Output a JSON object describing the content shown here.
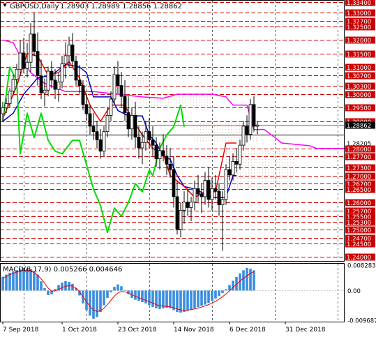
{
  "chart_data": {
    "type": "candlestick",
    "symbol_label": "GBPUSD,Daily",
    "ohlc_label": "1.28903 1.28989 1.28856 1.28862",
    "price_axis": {
      "ylim": [
        1.2385,
        1.3345
      ],
      "levels": [
        {
          "value": 1.334,
          "label": "1.33400",
          "style": "red"
        },
        {
          "value": 1.33,
          "label": "1.33000",
          "style": "red"
        },
        {
          "value": 1.327,
          "label": "1.32700",
          "style": "red"
        },
        {
          "value": 1.325,
          "label": "1.32500",
          "style": "red"
        },
        {
          "value": 1.32,
          "label": "1.32000",
          "style": "red"
        },
        {
          "value": 1.315,
          "label": "1.31500",
          "style": "red"
        },
        {
          "value": 1.31,
          "label": "1.31000",
          "style": "red"
        },
        {
          "value": 1.307,
          "label": "1.30700",
          "style": "red"
        },
        {
          "value": 1.303,
          "label": "1.30300",
          "style": "red"
        },
        {
          "value": 1.3,
          "label": "1.30000",
          "style": "red"
        },
        {
          "value": 1.295,
          "label": "1.29500",
          "style": "red"
        },
        {
          "value": 1.29,
          "label": "1.29000",
          "style": "red"
        },
        {
          "value": 1.28862,
          "label": "1.28862",
          "style": "current"
        },
        {
          "value": 1.285,
          "label": "",
          "style": "black"
        },
        {
          "value": 1.282,
          "label": "1.28205",
          "style": "plain"
        },
        {
          "value": 1.28,
          "label": "1.28000",
          "style": "red"
        },
        {
          "value": 1.277,
          "label": "1.27700",
          "style": "red"
        },
        {
          "value": 1.273,
          "label": "1.27300",
          "style": "red"
        },
        {
          "value": 1.27,
          "label": "1.27000",
          "style": "red"
        },
        {
          "value": 1.267,
          "label": "1.26700",
          "style": "red"
        },
        {
          "value": 1.265,
          "label": "1.26500",
          "style": "red"
        },
        {
          "value": 1.26,
          "label": "1.26000",
          "style": "red"
        },
        {
          "value": 1.257,
          "label": "1.25700",
          "style": "red"
        },
        {
          "value": 1.255,
          "label": "1.25500",
          "style": "red"
        },
        {
          "value": 1.253,
          "label": "1.25300",
          "style": "red"
        },
        {
          "value": 1.25,
          "label": "1.25000",
          "style": "red"
        },
        {
          "value": 1.247,
          "label": "1.24700",
          "style": "red"
        },
        {
          "value": 1.245,
          "label": "1.24500",
          "style": "red"
        },
        {
          "value": 1.24,
          "label": "1.24000",
          "style": "red"
        }
      ]
    },
    "x_labels": [
      {
        "index": 0,
        "label": "7 Sep 2018"
      },
      {
        "index": 17,
        "label": "1 Oct 2018"
      },
      {
        "index": 33,
        "label": "23 Oct 2018"
      },
      {
        "index": 49,
        "label": "14 Nov 2018"
      },
      {
        "index": 65,
        "label": "6 Dec 2018"
      },
      {
        "index": 81,
        "label": "31 Dec 2018"
      }
    ],
    "vertical_grid_at_index": [
      6,
      24,
      42,
      60,
      78,
      96
    ],
    "candles": [
      [
        1.2928,
        1.2972,
        1.29,
        1.295
      ],
      [
        1.295,
        1.2985,
        1.293,
        1.2965
      ],
      [
        1.2965,
        1.3022,
        1.295,
        1.3012
      ],
      [
        1.3012,
        1.3072,
        1.2995,
        1.3055
      ],
      [
        1.3055,
        1.3112,
        1.3028,
        1.3092
      ],
      [
        1.3092,
        1.3198,
        1.3072,
        1.3152
      ],
      [
        1.3152,
        1.3208,
        1.3078,
        1.3095
      ],
      [
        1.3095,
        1.3188,
        1.3062,
        1.3118
      ],
      [
        1.3118,
        1.3262,
        1.3082,
        1.3222
      ],
      [
        1.3222,
        1.3302,
        1.3142,
        1.3158
      ],
      [
        1.3158,
        1.3228,
        1.3032,
        1.3068
      ],
      [
        1.3068,
        1.3128,
        1.2982,
        1.3005
      ],
      [
        1.3005,
        1.3058,
        1.2955,
        1.3015
      ],
      [
        1.3015,
        1.3102,
        1.2992,
        1.3085
      ],
      [
        1.3085,
        1.3122,
        1.3022,
        1.3052
      ],
      [
        1.3052,
        1.3092,
        1.2982,
        1.3018
      ],
      [
        1.3018,
        1.3078,
        1.2972,
        1.3045
      ],
      [
        1.3045,
        1.3142,
        1.3022,
        1.3112
      ],
      [
        1.3112,
        1.3192,
        1.3058,
        1.3142
      ],
      [
        1.3142,
        1.3212,
        1.3098,
        1.3182
      ],
      [
        1.3182,
        1.3226,
        1.3102,
        1.3122
      ],
      [
        1.3122,
        1.3142,
        1.3032,
        1.3052
      ],
      [
        1.3052,
        1.3108,
        1.3002,
        1.3032
      ],
      [
        1.3032,
        1.3052,
        1.2942,
        1.2962
      ],
      [
        1.2962,
        1.2998,
        1.2902,
        1.2928
      ],
      [
        1.2928,
        1.2962,
        1.2852,
        1.2882
      ],
      [
        1.2882,
        1.2932,
        1.2832,
        1.2862
      ],
      [
        1.2862,
        1.2902,
        1.2802,
        1.2832
      ],
      [
        1.2832,
        1.2872,
        1.2762,
        1.279
      ],
      [
        1.279,
        1.2882,
        1.2772,
        1.2862
      ],
      [
        1.2862,
        1.2952,
        1.2842,
        1.2922
      ],
      [
        1.2922,
        1.3012,
        1.2902,
        1.2982
      ],
      [
        1.2982,
        1.3102,
        1.2962,
        1.3072
      ],
      [
        1.3072,
        1.3122,
        1.3002,
        1.3032
      ],
      [
        1.3032,
        1.3082,
        1.2952,
        1.2992
      ],
      [
        1.2992,
        1.3052,
        1.2902,
        1.2932
      ],
      [
        1.2932,
        1.2992,
        1.2842,
        1.2872
      ],
      [
        1.2872,
        1.2952,
        1.2832,
        1.2922
      ],
      [
        1.2922,
        1.2972,
        1.2802,
        1.2842
      ],
      [
        1.2842,
        1.2882,
        1.2762,
        1.2802
      ],
      [
        1.2802,
        1.2862,
        1.2742,
        1.2822
      ],
      [
        1.2822,
        1.2902,
        1.2792,
        1.2862
      ],
      [
        1.2862,
        1.2912,
        1.2802,
        1.2832
      ],
      [
        1.2832,
        1.2882,
        1.2772,
        1.2812
      ],
      [
        1.2812,
        1.2842,
        1.2732,
        1.2762
      ],
      [
        1.2762,
        1.2822,
        1.2722,
        1.2792
      ],
      [
        1.2792,
        1.2852,
        1.2752,
        1.2772
      ],
      [
        1.2772,
        1.2812,
        1.2702,
        1.2742
      ],
      [
        1.2742,
        1.2802,
        1.2692,
        1.2722
      ],
      [
        1.2722,
        1.2772,
        1.2582,
        1.2622
      ],
      [
        1.2622,
        1.2682,
        1.2482,
        1.2502
      ],
      [
        1.2502,
        1.2602,
        1.2472,
        1.2572
      ],
      [
        1.2572,
        1.2642,
        1.2522,
        1.2602
      ],
      [
        1.2602,
        1.2652,
        1.2552,
        1.2582
      ],
      [
        1.2582,
        1.2622,
        1.2532,
        1.2602
      ],
      [
        1.2602,
        1.2682,
        1.2572,
        1.2652
      ],
      [
        1.2652,
        1.2702,
        1.2602,
        1.2632
      ],
      [
        1.2632,
        1.2672,
        1.2562,
        1.2622
      ],
      [
        1.2622,
        1.2712,
        1.2592,
        1.2682
      ],
      [
        1.2682,
        1.2732,
        1.2582,
        1.2612
      ],
      [
        1.2612,
        1.2692,
        1.2572,
        1.2652
      ],
      [
        1.2652,
        1.2702,
        1.2612,
        1.2642
      ],
      [
        1.2642,
        1.2672,
        1.2552,
        1.2592
      ],
      [
        1.2592,
        1.2642,
        1.2422,
        1.2612
      ],
      [
        1.2612,
        1.2742,
        1.2592,
        1.2722
      ],
      [
        1.2722,
        1.2772,
        1.2682,
        1.2702
      ],
      [
        1.2702,
        1.2782,
        1.2682,
        1.2752
      ],
      [
        1.2752,
        1.2802,
        1.2712,
        1.2742
      ],
      [
        1.2742,
        1.2832,
        1.2722,
        1.2812
      ],
      [
        1.2812,
        1.2902,
        1.2792,
        1.2882
      ],
      [
        1.2882,
        1.2922,
        1.2822,
        1.2852
      ],
      [
        1.2852,
        1.2982,
        1.2832,
        1.2962
      ],
      [
        1.2962,
        1.2992,
        1.2862,
        1.2882
      ],
      [
        1.2882,
        1.2902,
        1.2852,
        1.28862
      ]
    ],
    "indicators": {
      "moving_average_magenta": [
        [
          0,
          1.32
        ],
        [
          3,
          1.319
        ],
        [
          5,
          1.314
        ],
        [
          8,
          1.308
        ],
        [
          12,
          1.304
        ],
        [
          18,
          1.301
        ],
        [
          26,
          1.301
        ],
        [
          33,
          1.3
        ],
        [
          40,
          1.299
        ],
        [
          46,
          1.2985
        ],
        [
          50,
          1.3
        ],
        [
          56,
          1.3
        ],
        [
          60,
          1.3
        ],
        [
          64,
          1.299
        ],
        [
          66,
          1.296
        ],
        [
          70,
          1.296
        ],
        [
          72,
          1.287
        ],
        [
          75,
          1.287
        ],
        [
          78,
          1.284
        ],
        [
          80,
          1.282
        ],
        [
          88,
          1.281
        ],
        [
          90,
          1.28
        ],
        [
          99,
          1.28
        ]
      ],
      "moving_average_blue": [
        [
          0,
          1.29
        ],
        [
          3,
          1.293
        ],
        [
          6,
          1.3
        ],
        [
          10,
          1.306
        ],
        [
          14,
          1.307
        ],
        [
          18,
          1.311
        ],
        [
          22,
          1.31
        ],
        [
          24,
          1.308
        ],
        [
          26,
          1.299
        ],
        [
          31,
          1.299
        ],
        [
          33,
          1.294
        ],
        [
          36,
          1.292
        ],
        [
          40,
          1.292
        ],
        [
          42,
          1.285
        ],
        [
          44,
          1.282
        ],
        [
          46,
          1.277
        ],
        [
          48,
          1.276
        ],
        [
          50,
          1.27
        ],
        [
          52,
          1.266
        ],
        [
          55,
          1.265
        ],
        [
          60,
          1.262
        ],
        [
          64,
          1.262
        ],
        [
          66,
          1.27
        ],
        [
          67,
          1.27
        ]
      ],
      "moving_average_red": [
        [
          0,
          1.291
        ],
        [
          4,
          1.303
        ],
        [
          7,
          1.315
        ],
        [
          10,
          1.314
        ],
        [
          13,
          1.307
        ],
        [
          16,
          1.308
        ],
        [
          19,
          1.312
        ],
        [
          22,
          1.306
        ],
        [
          25,
          1.296
        ],
        [
          28,
          1.29
        ],
        [
          31,
          1.296
        ],
        [
          35,
          1.296
        ],
        [
          37,
          1.291
        ],
        [
          40,
          1.285
        ],
        [
          43,
          1.28
        ],
        [
          46,
          1.278
        ],
        [
          48,
          1.27
        ],
        [
          52,
          1.266
        ],
        [
          55,
          1.262
        ],
        [
          58,
          1.264
        ],
        [
          61,
          1.264
        ],
        [
          64,
          1.282
        ],
        [
          67,
          1.282
        ]
      ],
      "lagging_green": [
        [
          0,
          1.29
        ],
        [
          2,
          1.31
        ],
        [
          4,
          1.305
        ],
        [
          5,
          1.278
        ],
        [
          7,
          1.293
        ],
        [
          9,
          1.284
        ],
        [
          11,
          1.293
        ],
        [
          13,
          1.283
        ],
        [
          15,
          1.279
        ],
        [
          17,
          1.278
        ],
        [
          20,
          1.283
        ],
        [
          22,
          1.283
        ],
        [
          24,
          1.274
        ],
        [
          26,
          1.265
        ],
        [
          28,
          1.259
        ],
        [
          30,
          1.249
        ],
        [
          32,
          1.258
        ],
        [
          34,
          1.255
        ],
        [
          36,
          1.26
        ],
        [
          38,
          1.267
        ],
        [
          40,
          1.264
        ],
        [
          42,
          1.272
        ],
        [
          43,
          1.27
        ],
        [
          45,
          1.28
        ],
        [
          47,
          1.285
        ],
        [
          49,
          1.288
        ],
        [
          50,
          1.292
        ],
        [
          51,
          1.296
        ],
        [
          52,
          1.288
        ]
      ]
    },
    "cloud_rows": [
      [
        37,
        45,
        1.308,
        1.302
      ],
      [
        37,
        60,
        1.3,
        1.295
      ],
      [
        55,
        73,
        1.29,
        1.282
      ],
      [
        64,
        84,
        1.28,
        1.272
      ],
      [
        64,
        84,
        1.272,
        1.264
      ]
    ],
    "current_price": 1.28862,
    "macd": {
      "label": "MACD(8,17,9) 0.005266 0.004646",
      "ylim": [
        -0.009687,
        0.008283
      ],
      "levels": [
        {
          "value": 0.008283,
          "label": "0.008283"
        },
        {
          "value": 0.0,
          "label": "0.00"
        },
        {
          "value": -0.009687,
          "label": "-0.009687"
        }
      ],
      "histogram": [
        0.0045,
        0.0052,
        0.0058,
        0.0062,
        0.0066,
        0.0071,
        0.0074,
        0.0072,
        0.007,
        0.0064,
        0.0052,
        0.003,
        0.0008,
        -0.0015,
        -0.0012,
        0.0005,
        0.0018,
        0.0026,
        0.0031,
        0.0028,
        0.0022,
        0.0008,
        -0.0016,
        -0.0042,
        -0.0064,
        -0.0082,
        -0.0092,
        -0.0086,
        -0.007,
        -0.0048,
        -0.0024,
        -0.0006,
        0.0012,
        0.002,
        0.0014,
        0.0002,
        -0.0012,
        -0.0024,
        -0.003,
        -0.0034,
        -0.0038,
        -0.0042,
        -0.0048,
        -0.0054,
        -0.0058,
        -0.006,
        -0.0058,
        -0.0056,
        -0.0058,
        -0.0064,
        -0.007,
        -0.0072,
        -0.007,
        -0.0066,
        -0.0062,
        -0.0058,
        -0.0054,
        -0.005,
        -0.0046,
        -0.004,
        -0.0034,
        -0.0026,
        -0.0018,
        -0.0008,
        0.0004,
        0.0018,
        0.0032,
        0.0044,
        0.0056,
        0.0066,
        0.0074,
        0.0071,
        0.0066
      ],
      "signal": [
        0.004,
        0.0046,
        0.0052,
        0.0056,
        0.006,
        0.0064,
        0.0066,
        0.0066,
        0.0064,
        0.0058,
        0.005,
        0.0038,
        0.0024,
        0.0008,
        -0.0002,
        -0.0001,
        0.0004,
        0.001,
        0.0014,
        0.0016,
        0.0014,
        0.0008,
        -0.0004,
        -0.002,
        -0.0036,
        -0.0052,
        -0.0064,
        -0.0068,
        -0.0066,
        -0.0058,
        -0.0046,
        -0.0032,
        -0.0018,
        -0.0008,
        -0.0003,
        -0.0004,
        -0.0008,
        -0.0014,
        -0.0019,
        -0.0023,
        -0.0028,
        -0.0032,
        -0.0036,
        -0.0041,
        -0.0046,
        -0.0049,
        -0.0051,
        -0.0052,
        -0.0053,
        -0.0056,
        -0.006,
        -0.0063,
        -0.0064,
        -0.0064,
        -0.0062,
        -0.006,
        -0.0057,
        -0.0054,
        -0.005,
        -0.0046,
        -0.0041,
        -0.0035,
        -0.0028,
        -0.002,
        -0.0011,
        -0.0001,
        0.001,
        0.002,
        0.0031,
        0.004,
        0.0048,
        0.0056,
        0.0062
      ]
    }
  }
}
